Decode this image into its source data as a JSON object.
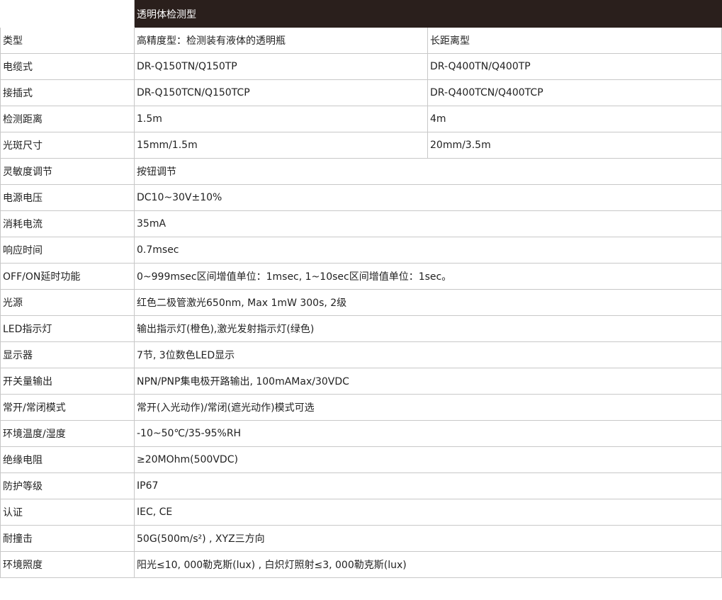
{
  "header": {
    "label": "",
    "title": "透明体检测型"
  },
  "colors": {
    "header_bg": "#2a1f1c",
    "border": "#c8c8c8"
  },
  "rows": [
    {
      "label": "类型",
      "a": "高精度型：检测装有液体的透明瓶",
      "b": "长距离型"
    },
    {
      "label": "电缆式",
      "a": "DR-Q150TN/Q150TP",
      "b": "DR-Q400TN/Q400TP"
    },
    {
      "label": "接插式",
      "a": "DR-Q150TCN/Q150TCP",
      "b": "DR-Q400TCN/Q400TCP"
    },
    {
      "label": "检测距离",
      "a": "1.5m",
      "b": "4m"
    },
    {
      "label": "光斑尺寸",
      "a": "15mm/1.5m",
      "b": "20mm/3.5m"
    },
    {
      "label": "灵敏度调节",
      "value": "按钮调节"
    },
    {
      "label": "电源电压",
      "value": "DC10~30V±10%"
    },
    {
      "label": "消耗电流",
      "value": "35mA"
    },
    {
      "label": "响应时间",
      "value": "0.7msec"
    },
    {
      "label": "OFF/ON延时功能",
      "value": "0~999msec区间增值单位：1msec, 1~10sec区间增值单位：1sec。"
    },
    {
      "label": "光源",
      "value": "红色二极管激光650nm, Max 1mW 300s, 2级"
    },
    {
      "label": "LED指示灯",
      "value": "输出指示灯(橙色),激光发射指示灯(绿色)"
    },
    {
      "label": "显示器",
      "value": "7节, 3位数色LED显示"
    },
    {
      "label": "开关量输出",
      "value": "NPN/PNP集电极开路输出, 100mAMax/30VDC"
    },
    {
      "label": "常开/常闭模式",
      "value": "常开(入光动作)/常闭(遮光动作)模式可选"
    },
    {
      "label": "环境温度/湿度",
      "value": "-10~50℃/35-95%RH"
    },
    {
      "label": "绝缘电阻",
      "value": "≥20MOhm(500VDC)"
    },
    {
      "label": "防护等级",
      "value": "IP67"
    },
    {
      "label": "认证",
      "value": "IEC, CE"
    },
    {
      "label": "耐撞击",
      "value": "50G(500m/s²) , XYZ三方向"
    },
    {
      "label": "环境照度",
      "value": "阳光≤10, 000勒克斯(lux) , 白炽灯照射≤3, 000勒克斯(lux)"
    }
  ]
}
